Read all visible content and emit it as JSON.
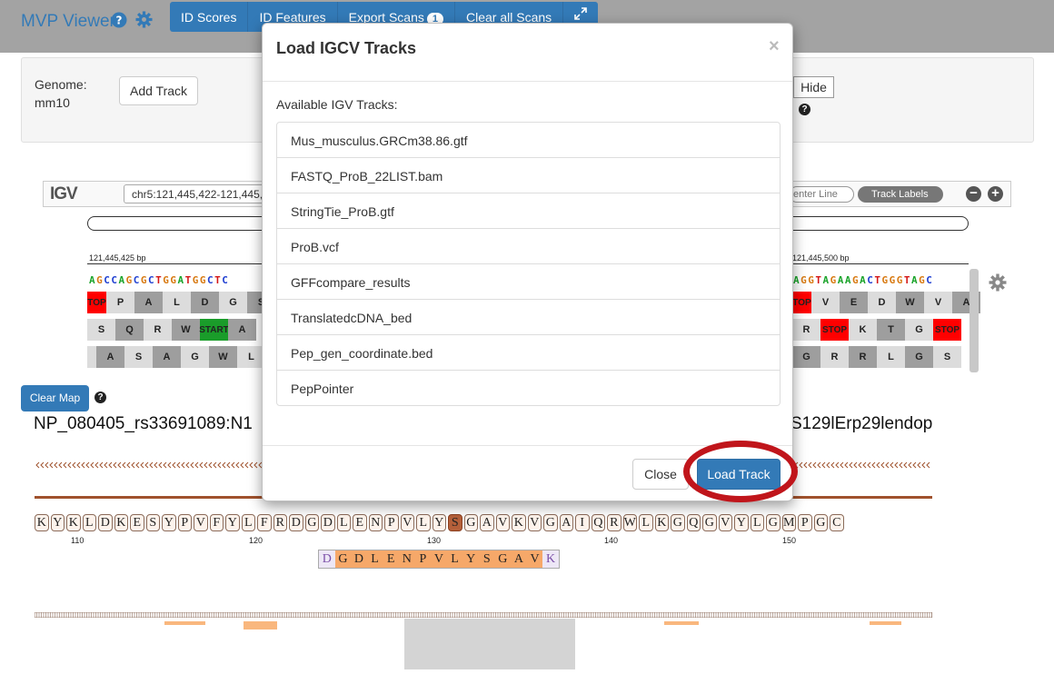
{
  "navbar": {
    "title": "MVP Viewer",
    "buttons": [
      {
        "label": "ID Scores"
      },
      {
        "label": "ID Features"
      },
      {
        "label": "Export Scans",
        "badge": "1"
      },
      {
        "label": "Clear all Scans"
      }
    ]
  },
  "genome_panel": {
    "genome_label": "Genome:",
    "genome_value": "mm10",
    "add_track": "Add Track",
    "hide": "Hide"
  },
  "igv": {
    "logo": "IGV",
    "locus": "chr5:121,445,422-121,445,",
    "center_line": "enter Line",
    "track_labels": "Track Labels",
    "coord_left": "121,445,425 bp",
    "coord_right": "121,445,500 bp",
    "seq_left": "AGCCAGCGCTGGATGGCTC",
    "seq_right": "AGGTAGAAGACTGGGTAGC",
    "frame1_left": [
      "TOP",
      "P",
      "A",
      "L",
      "D",
      "G",
      "S"
    ],
    "frame2_left": [
      "S",
      "Q",
      "R",
      "W",
      "START",
      "A"
    ],
    "frame3_left": [
      "A",
      "S",
      "A",
      "G",
      "W",
      "L"
    ],
    "frame1_right": [
      "TOP",
      "V",
      "E",
      "D",
      "W",
      "V",
      "A"
    ],
    "frame2_right": [
      "R",
      "STOP",
      "K",
      "T",
      "G",
      "STOP"
    ],
    "frame3_right": [
      "G",
      "R",
      "R",
      "L",
      "G",
      "S"
    ]
  },
  "viewer": {
    "clear_map": "Clear Map",
    "protein_name_left": "NP_080405_rs33691089:N1",
    "protein_name_right": "S129lErp29lendop",
    "residues": [
      "K",
      "Y",
      "K",
      "L",
      "D",
      "K",
      "E",
      "S",
      "Y",
      "P",
      "V",
      "F",
      "Y",
      "L",
      "F",
      "R",
      "D",
      "G",
      "D",
      "L",
      "E",
      "N",
      "P",
      "V",
      "L",
      "Y",
      "S",
      "G",
      "A",
      "V",
      "K",
      "V",
      "G",
      "A",
      "I",
      "Q",
      "R",
      "W",
      "L",
      "K",
      "G",
      "Q",
      "G",
      "V",
      "Y",
      "L",
      "G",
      "M",
      "P",
      "G",
      "C"
    ],
    "highlight_index": 26,
    "ticks": [
      "110",
      "120",
      "130",
      "140",
      "150"
    ],
    "peptide": [
      "D",
      "G",
      "D",
      "L",
      "E",
      "N",
      "P",
      "V",
      "L",
      "Y",
      "S",
      "G",
      "A",
      "V",
      "K"
    ]
  },
  "modal": {
    "title": "Load IGCV Tracks",
    "close_x": "×",
    "available_label": "Available IGV Tracks:",
    "tracks": [
      "Mus_musculus.GRCm38.86.gtf",
      "FASTQ_ProB_22LIST.bam",
      "StringTie_ProB.gtf",
      "ProB.vcf",
      "GFFcompare_results",
      "TranslatedcDNA_bed",
      "Pep_gen_coordinate.bed",
      "PepPointer"
    ],
    "close_button": "Close",
    "load_button": "Load Track"
  },
  "colors": {
    "primary": "#337ab7",
    "stop": "#ff0000",
    "start": "#1a9c2a",
    "highlight_ring": "#c0151b",
    "peptide": "#f6a869"
  }
}
